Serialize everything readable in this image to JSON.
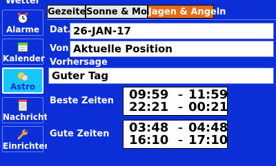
{
  "sidebar": {
    "title": "Wetter",
    "items": [
      {
        "label": "Alarme",
        "icon": "alarm-clock-icon"
      },
      {
        "label": "Kalender",
        "icon": "calendar-icon"
      },
      {
        "label": "Astro",
        "icon": "sun-moon-icon"
      },
      {
        "label": "Nachricht",
        "icon": "message-icon"
      },
      {
        "label": "Einrichten",
        "icon": "wrench-icon"
      }
    ],
    "active": "Astro"
  },
  "tabs": [
    {
      "label": "Gezeiten"
    },
    {
      "label": "Sonne & Mond"
    },
    {
      "label": "Jagen & Angeln"
    }
  ],
  "active_tab": "Jagen & Angeln",
  "form": {
    "date_label": "Dat.",
    "date_value": "26-JAN-17",
    "from_label": "Von",
    "from_value": "Aktuelle Position",
    "forecast_label": "Vorhersage",
    "forecast_value": "Guter Tag"
  },
  "best_times": {
    "label": "Beste Zeiten",
    "rows": [
      {
        "start": "09:59",
        "sep": "–",
        "end": "11:59"
      },
      {
        "start": "22:21",
        "sep": "–",
        "end": "00:21"
      }
    ]
  },
  "good_times": {
    "label": "Gute Zeiten",
    "rows": [
      {
        "start": "03:48",
        "sep": "–",
        "end": "04:48"
      },
      {
        "start": "16:10",
        "sep": "–",
        "end": "17:10"
      }
    ]
  },
  "colors": {
    "background": "#0a2fd6",
    "active_tab": "#e86a12",
    "active_sidebar": "#15c6ff"
  }
}
